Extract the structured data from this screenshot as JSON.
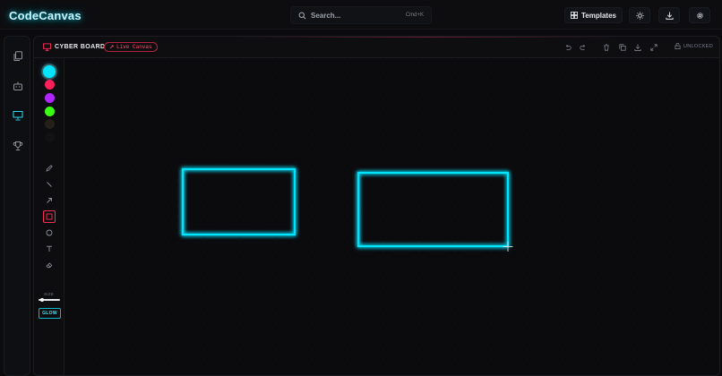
{
  "app": {
    "logo": "CodeCanvas"
  },
  "search": {
    "placeholder": "Search...",
    "shortcut": "Cmd+K"
  },
  "toolbar": {
    "templates_label": "Templates"
  },
  "board": {
    "title": "CYBER BOARD",
    "live_badge": "Live Canvas",
    "lock_status": "UNLOCKED"
  },
  "tools": {
    "size_label": "SIZE",
    "size_value": 0.1,
    "glow_label": "GLOW",
    "active_tool": "rectangle"
  },
  "colors": {
    "swatches": [
      "#00e5ff",
      "#ff1f5a",
      "#b026ff",
      "#39ff14",
      "#242018",
      "#121212"
    ],
    "active_swatch": "#00e5ff",
    "accent": "#00e5ff",
    "danger": "#ff2f5a"
  },
  "icons": {
    "nav": [
      "files-icon",
      "robot-icon",
      "presentation-icon",
      "trophy-icon"
    ],
    "header_actions": [
      "undo-icon",
      "redo-icon",
      "trash-icon",
      "copy-icon",
      "download-icon",
      "expand-icon"
    ]
  }
}
